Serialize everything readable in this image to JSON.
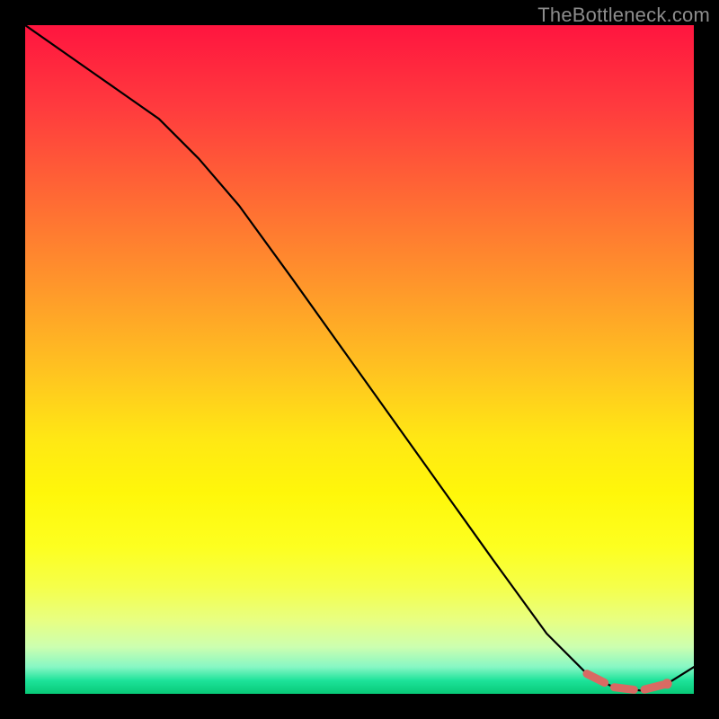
{
  "header": {
    "watermark": "TheBottleneck.com"
  },
  "colors": {
    "page_bg": "#000000",
    "curve": "#000000",
    "highlight": "#d96a63",
    "watermark": "#8c8c8c",
    "gradient_top": "#ff153f",
    "gradient_bottom": "#08c977"
  },
  "chart_data": {
    "type": "line",
    "title": "",
    "xlabel": "",
    "ylabel": "",
    "xlim": [
      0,
      100
    ],
    "ylim": [
      0,
      100
    ],
    "series": [
      {
        "name": "main-curve",
        "x": [
          0,
          10,
          20,
          26,
          32,
          40,
          50,
          60,
          70,
          78,
          84,
          88,
          92,
          96,
          100
        ],
        "y": [
          100,
          93,
          86,
          80,
          73,
          62,
          48,
          34,
          20,
          9,
          3,
          1,
          0.5,
          1.5,
          4
        ]
      },
      {
        "name": "highlight-segment",
        "x": [
          84,
          88,
          92,
          96
        ],
        "y": [
          3,
          1,
          0.5,
          1.5
        ]
      }
    ],
    "highlight_end_point": {
      "x": 96,
      "y": 1.5
    }
  }
}
